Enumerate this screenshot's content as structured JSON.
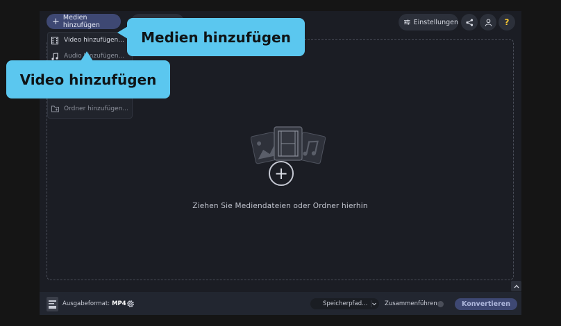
{
  "header": {
    "add_media_label": "Medien hinzufügen",
    "settings_label": "Einstellungen"
  },
  "menu": {
    "items": [
      {
        "label": "Video hinzufügen...",
        "icon": "video-file-icon"
      },
      {
        "label": "Audio hinzufügen...",
        "icon": "music-note-icon"
      },
      {
        "label": "Ordner hinzufügen...",
        "icon": "folder-add-icon"
      }
    ]
  },
  "dropzone": {
    "text": "Ziehen Sie Mediendateien oder Ordner hierhin"
  },
  "footer": {
    "output_format_label": "Ausgabeformat:",
    "output_format_value": "MP4",
    "save_path_label": "Speicherpfad...",
    "merge_label": "Zusammenführen:",
    "convert_label": "Konvertieren"
  },
  "tooltips": {
    "media": "Medien hinzufügen",
    "video": "Video hinzufügen"
  },
  "colors": {
    "accent": "#3e4873",
    "tooltip": "#5bc7ef",
    "help": "#f4c531"
  }
}
